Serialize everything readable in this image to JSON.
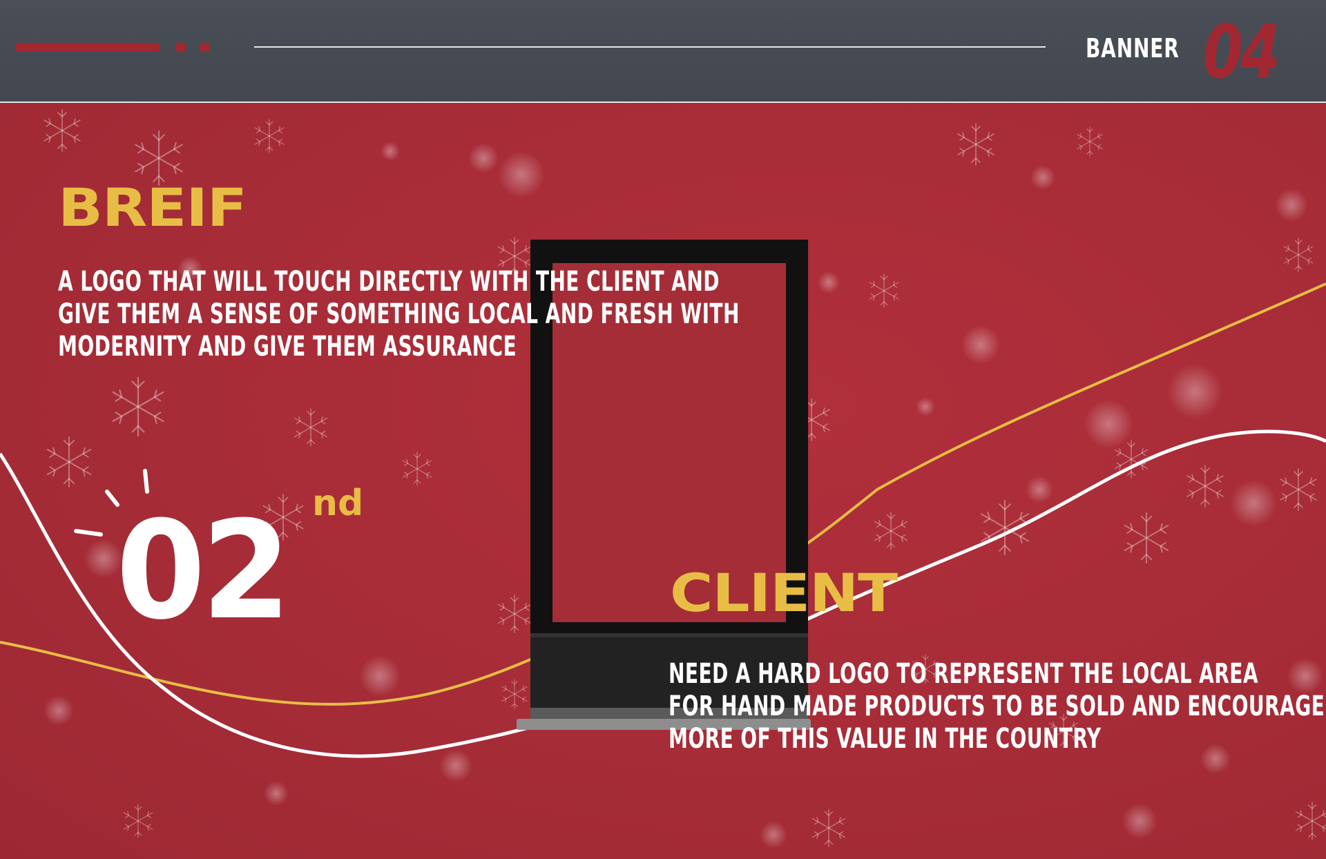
{
  "header": {
    "label": "BANNER",
    "number": "04"
  },
  "brief": {
    "title": "BREIF",
    "lines": [
      "A LOGO THAT WILL TOUCH DIRECTLY WITH THE CLIENT AND",
      "GIVE THEM A SENSE OF SOMETHING LOCAL AND FRESH WITH",
      "MODERNITY AND GIVE THEM ASSURANCE"
    ]
  },
  "rank": {
    "number": "02",
    "suffix": "nd"
  },
  "client": {
    "title": "CLIENT",
    "lines": [
      "NEED A HARD LOGO TO REPRESENT THE LOCAL AREA",
      "FOR HAND MADE PRODUCTS TO BE SOLD AND ENCOURAGE",
      "MORE OF THIS VALUE IN THE COUNTRY"
    ]
  },
  "colors": {
    "background_red": "#a52d38",
    "header_gray": "#464a52",
    "accent_yellow": "#e8bd45",
    "accent_dark_red": "#a32731",
    "text_white": "#ffffff",
    "stand_black": "#111111"
  },
  "icons": {
    "decor": "snowflake-icon",
    "mockup": "banner-stand-mockup"
  }
}
